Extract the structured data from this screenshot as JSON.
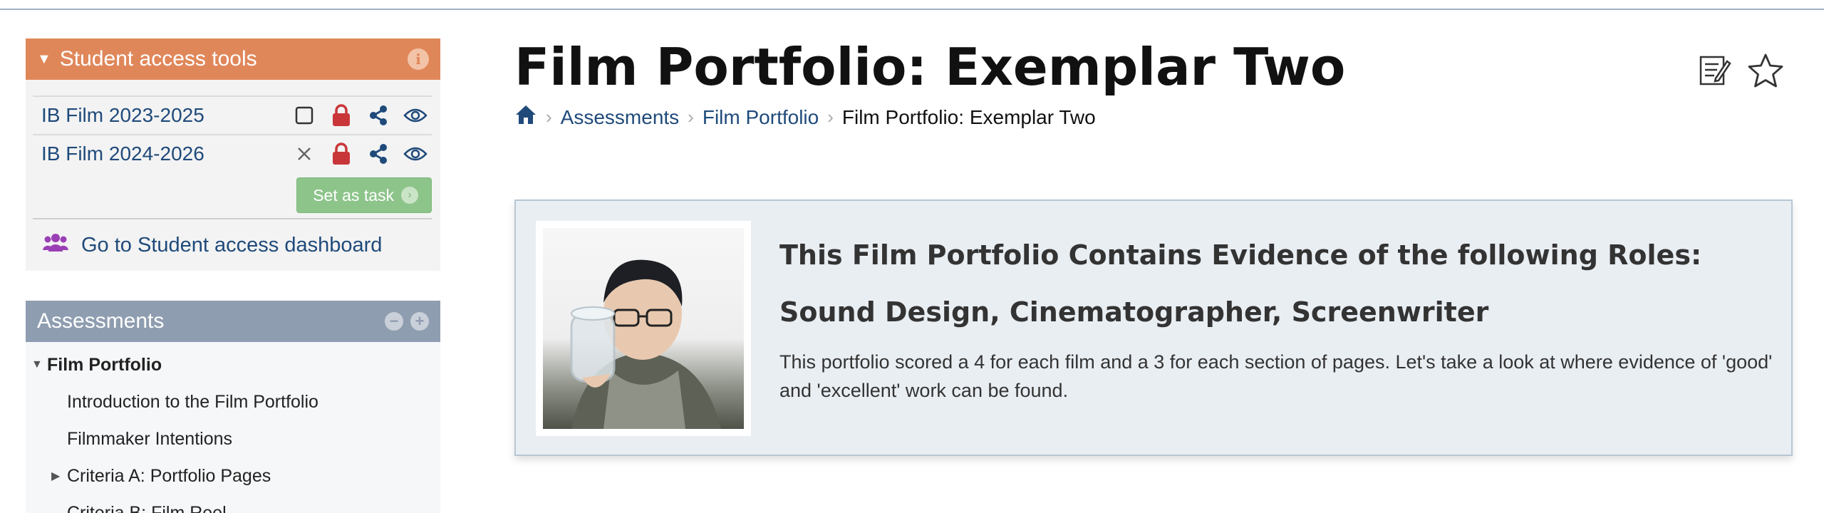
{
  "sidebar": {
    "student_access": {
      "title": "Student access tools",
      "classes": [
        {
          "name": "IB Film 2023-2025",
          "status_icon": "checkbox-empty-icon"
        },
        {
          "name": "IB Film 2024-2026",
          "status_icon": "close-x-icon"
        }
      ],
      "set_task_label": "Set as task",
      "dashboard_label": "Go to Student access dashboard"
    },
    "assessments": {
      "title": "Assessments",
      "items": [
        {
          "label": "Film Portfolio"
        },
        {
          "label": "Introduction to the Film Portfolio"
        },
        {
          "label": "Filmmaker Intentions"
        },
        {
          "label": "Criteria A: Portfolio Pages"
        },
        {
          "label": "Criteria B: Film Reel"
        }
      ]
    }
  },
  "main": {
    "title": "Film Portfolio: Exemplar Two",
    "breadcrumb": {
      "links": [
        "Assessments",
        "Film Portfolio"
      ],
      "current": "Film Portfolio: Exemplar Two"
    },
    "callout": {
      "heading": "This Film Portfolio Contains Evidence of the following Roles: Sound Design, Cinematographer, Screenwriter",
      "body": "This portfolio scored a 4 for each film and a 3 for each section of pages.  Let's take a look at where evidence of 'good' and 'excellent' work can be found."
    }
  },
  "colors": {
    "student_access_header": "#e0875a",
    "assessments_header": "#8e9db0",
    "link": "#1f4a7a",
    "lock": "#c9363a",
    "set_task_button": "#8dc48a",
    "dashboard_icon": "#9b3fb5"
  }
}
